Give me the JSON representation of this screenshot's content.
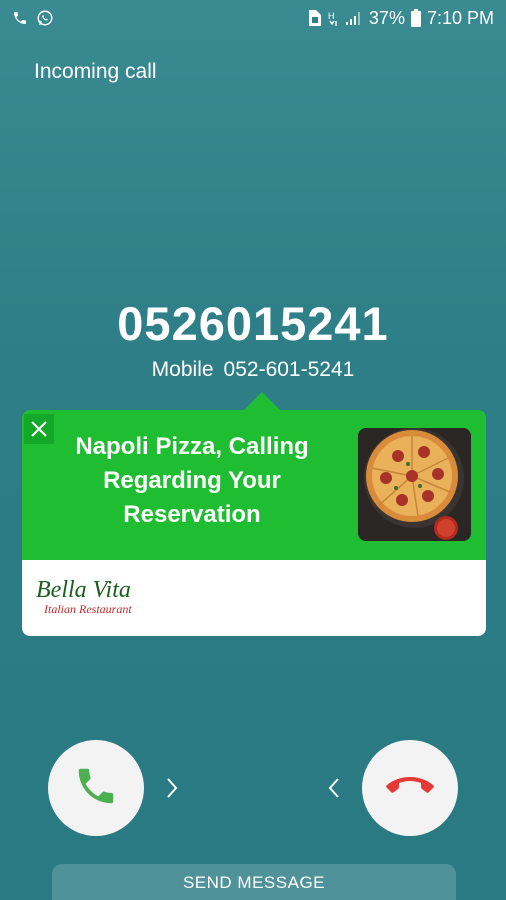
{
  "status_bar": {
    "left_icons": [
      "phone-icon",
      "whatsapp-icon"
    ],
    "right_icons": [
      "sim-icon",
      "network-icon",
      "signal-icon"
    ],
    "battery": "37%",
    "time": "7:10 PM"
  },
  "call": {
    "state_label": "Incoming call",
    "number": "0526015241",
    "type": "Mobile",
    "formatted_number": "052-601-5241"
  },
  "card": {
    "message": "Napoli Pizza, Calling Regarding Your Reservation",
    "logo_line1": "Bella Vita",
    "logo_line2": "Italian Restaurant",
    "accent_color": "#1fbd32",
    "image_icon": "pizza-image"
  },
  "actions": {
    "accept_icon": "phone-icon",
    "decline_icon": "phone-hangup-icon",
    "send_message": "SEND MESSAGE",
    "accept_color": "#4caf50",
    "decline_color": "#e53935"
  }
}
